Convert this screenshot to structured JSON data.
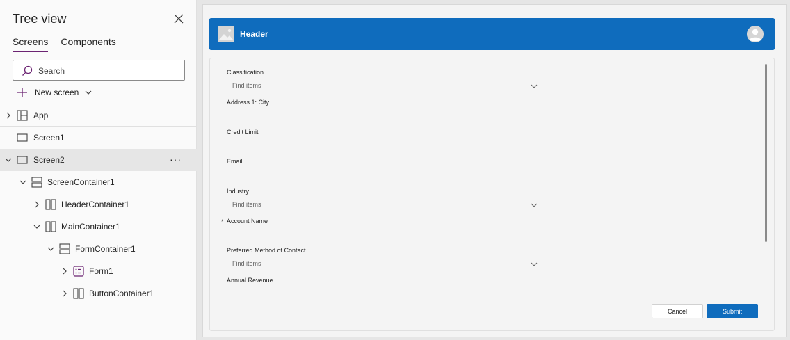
{
  "tree_view": {
    "title": "Tree view",
    "tabs": [
      {
        "label": "Screens",
        "active": true
      },
      {
        "label": "Components",
        "active": false
      }
    ],
    "search": {
      "placeholder": "Search",
      "value": ""
    },
    "new_screen_label": "New screen",
    "nodes": [
      {
        "label": "App",
        "icon": "app-icon",
        "expanded": false
      },
      {
        "label": "Screen1",
        "icon": "screen-icon"
      },
      {
        "label": "Screen2",
        "icon": "screen-icon",
        "expanded": true,
        "selected": true,
        "more": "···"
      },
      {
        "label": "ScreenContainer1",
        "icon": "vertical-container-icon",
        "expanded": true
      },
      {
        "label": "HeaderContainer1",
        "icon": "horizontal-container-icon",
        "expanded": false
      },
      {
        "label": "MainContainer1",
        "icon": "horizontal-container-icon",
        "expanded": true
      },
      {
        "label": "FormContainer1",
        "icon": "vertical-container-icon",
        "expanded": true
      },
      {
        "label": "Form1",
        "icon": "form-icon",
        "expanded": false
      },
      {
        "label": "ButtonContainer1",
        "icon": "horizontal-container-icon",
        "expanded": false
      }
    ]
  },
  "canvas": {
    "header": {
      "title": "Header",
      "image_icon": "image-placeholder-icon",
      "avatar_icon": "user-avatar-icon"
    },
    "form": {
      "fields": [
        {
          "label": "Classification",
          "type": "select",
          "placeholder": "Find items",
          "required": false
        },
        {
          "label": "Address 1: City",
          "type": "text",
          "required": false
        },
        {
          "label": "Credit Limit",
          "type": "text",
          "required": false
        },
        {
          "label": "Email",
          "type": "text",
          "required": false
        },
        {
          "label": "Industry",
          "type": "select",
          "placeholder": "Find items",
          "required": false
        },
        {
          "label": "Account Name",
          "type": "text",
          "required": true,
          "required_marker": "*"
        },
        {
          "label": "Preferred Method of Contact",
          "type": "select",
          "placeholder": "Find items",
          "required": false
        },
        {
          "label": "Annual Revenue",
          "type": "text",
          "required": false
        }
      ],
      "cancel_label": "Cancel",
      "submit_label": "Submit"
    }
  },
  "colors": {
    "accent": "#0f6cbd",
    "tab_underline": "#6b2372",
    "selection": "#e6e6e6"
  }
}
